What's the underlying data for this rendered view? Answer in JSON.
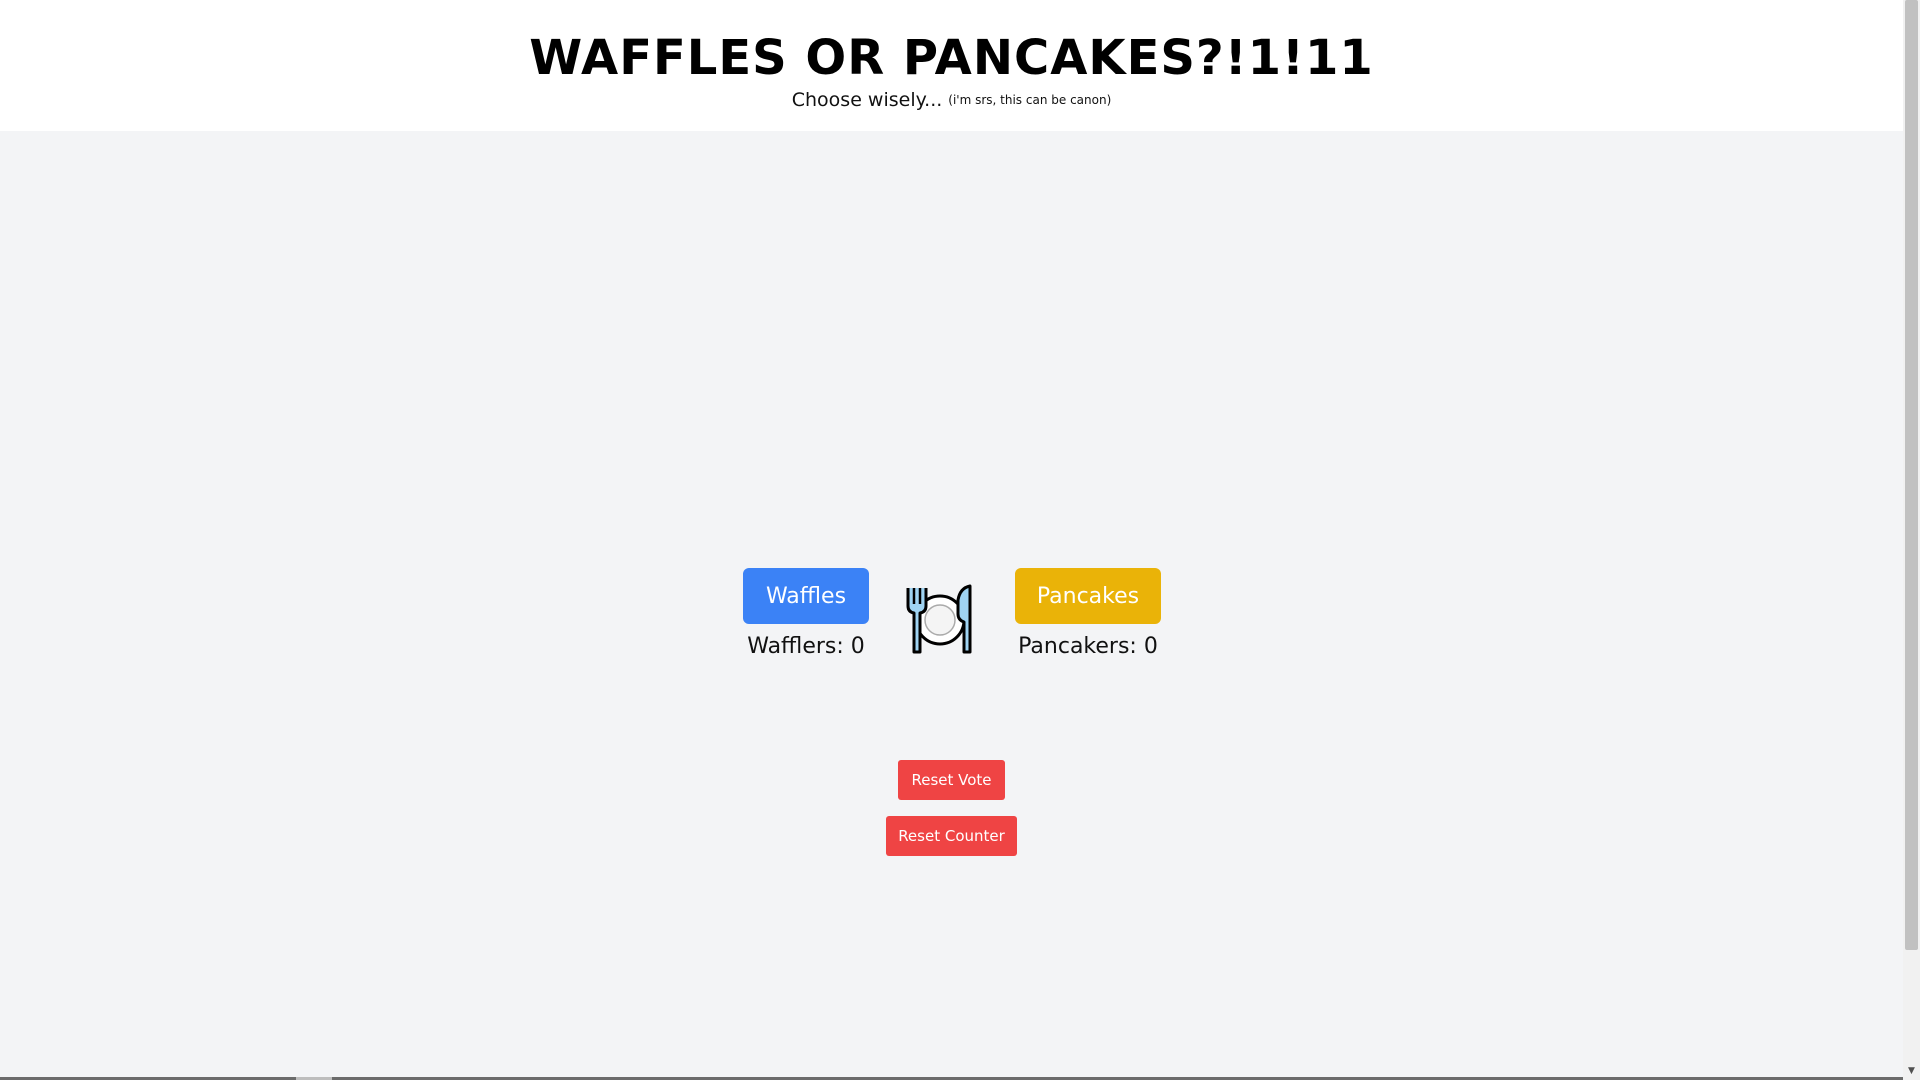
{
  "header": {
    "title": "WAFFLES OR PANCAKES?!1!11",
    "subtitle": "Choose wisely...",
    "subtitle_small": "(i'm srs, this can be canon)"
  },
  "vote": {
    "waffles_label": "Waffles",
    "pancakes_label": "Pancakes",
    "waffles_count": "Wafflers: 0",
    "pancakes_count": "Pancakers: 0",
    "center_icon": "fork-knife-plate-icon"
  },
  "actions": {
    "reset_vote_label": "Reset Vote",
    "reset_counter_label": "Reset Counter"
  },
  "colors": {
    "waffles": "#3b82f6",
    "pancakes": "#eab308",
    "reset": "#ef4444",
    "background": "#f3f4f6",
    "header_background": "#ffffff"
  }
}
